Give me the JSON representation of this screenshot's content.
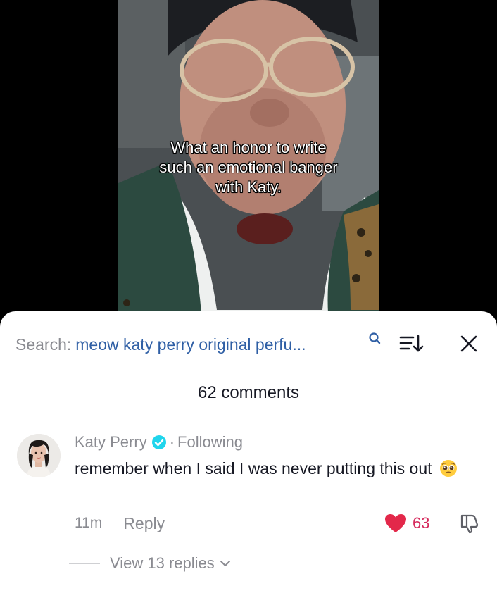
{
  "video": {
    "caption": "What an honor to write\nsuch an emotional banger\nwith Katy."
  },
  "search": {
    "prefix": "Search:",
    "query": "meow katy perry original perfu..."
  },
  "comments": {
    "count_label": "62 comments",
    "items": [
      {
        "author": "Katy Perry",
        "separator": "·",
        "relation": "Following",
        "text": "remember when I said I was never putting this out",
        "emoji": "pleading-face",
        "time": "11m",
        "reply_label": "Reply",
        "likes": "63",
        "view_replies": "View 13 replies"
      }
    ]
  },
  "colors": {
    "link": "#2f5fa5",
    "like": "#d62b5d",
    "verified": "#20d5ec",
    "muted": "#8a8b91"
  },
  "icons": [
    "search-icon",
    "sort-icon",
    "close-icon",
    "verified-badge-icon",
    "heart-icon",
    "dislike-icon",
    "chevron-down-icon",
    "pleading-face-emoji"
  ]
}
